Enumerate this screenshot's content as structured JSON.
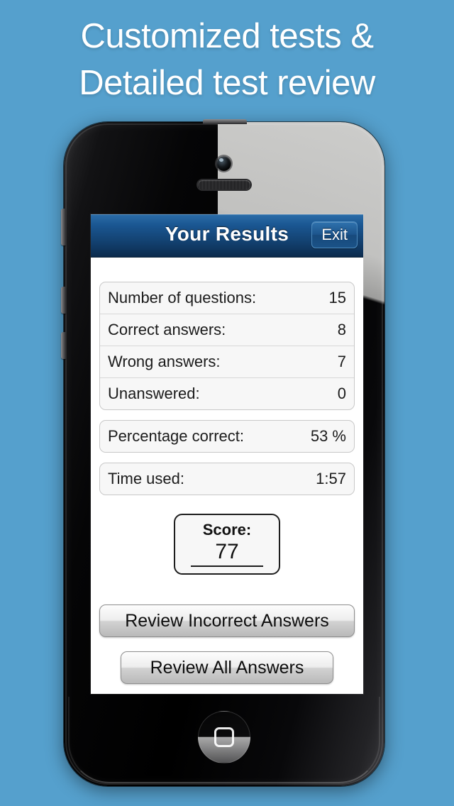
{
  "promo": {
    "line1": "Customized tests &",
    "line2": "Detailed test review"
  },
  "colors": {
    "background": "#55a0cd",
    "navbar_top": "#2b6da9",
    "navbar_bottom": "#0c2c4d",
    "exit_button": "#1d558c",
    "panel_background": "#f7f7f7",
    "text": "#1b1b1b"
  },
  "app": {
    "navbar": {
      "title": "Your Results",
      "exit_label": "Exit"
    },
    "stats_group_main": [
      {
        "label": "Number of questions:",
        "value": "15"
      },
      {
        "label": "Correct answers:",
        "value": "8"
      },
      {
        "label": "Wrong answers:",
        "value": "7"
      },
      {
        "label": "Unanswered:",
        "value": "0"
      }
    ],
    "stats_percentage": {
      "label": "Percentage correct:",
      "value": "53 %"
    },
    "stats_time": {
      "label": "Time used:",
      "value": "1:57"
    },
    "score": {
      "title": "Score:",
      "value": "77"
    },
    "actions": {
      "review_incorrect": "Review Incorrect Answers",
      "review_all": "Review All Answers"
    }
  }
}
